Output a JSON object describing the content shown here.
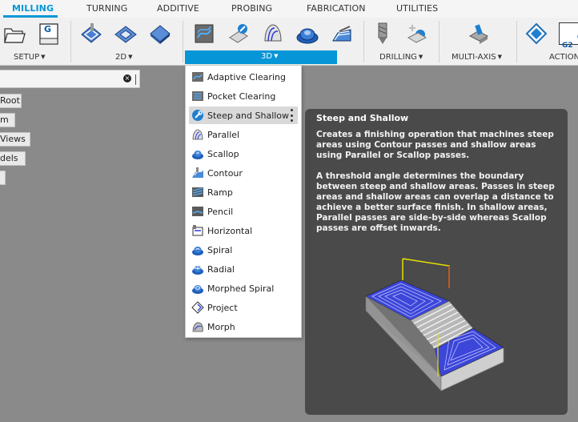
{
  "tabs": [
    {
      "label": "MILLING",
      "active": true
    },
    {
      "label": "TURNING",
      "active": false
    },
    {
      "label": "ADDITIVE",
      "active": false
    },
    {
      "label": "PROBING",
      "active": false
    },
    {
      "label": "FABRICATION",
      "active": false
    },
    {
      "label": "UTILITIES",
      "active": false
    }
  ],
  "groups": {
    "setup": "SETUP",
    "twod": "2D",
    "threed": "3D",
    "drilling": "DRILLING",
    "multiaxis": "MULTI-AXIS",
    "actions": "ACTION"
  },
  "nc_icon_text": "G1\nG2",
  "setup_sheet_letter": "G",
  "browser": {
    "search_clear_icon": "clear-icon",
    "chips": [
      "Root",
      "m",
      "Views",
      "dels",
      ""
    ]
  },
  "menu_items": [
    {
      "label": "Adaptive Clearing",
      "icon": "adaptive-clearing-icon"
    },
    {
      "label": "Pocket Clearing",
      "icon": "pocket-clearing-icon"
    },
    {
      "label": "Steep and Shallow",
      "icon": "steep-and-shallow-icon",
      "highlighted": true
    },
    {
      "label": "Parallel",
      "icon": "parallel-icon"
    },
    {
      "label": "Scallop",
      "icon": "scallop-icon"
    },
    {
      "label": "Contour",
      "icon": "contour-icon"
    },
    {
      "label": "Ramp",
      "icon": "ramp-icon"
    },
    {
      "label": "Pencil",
      "icon": "pencil-icon"
    },
    {
      "label": "Horizontal",
      "icon": "horizontal-icon"
    },
    {
      "label": "Spiral",
      "icon": "spiral-icon"
    },
    {
      "label": "Radial",
      "icon": "radial-icon"
    },
    {
      "label": "Morphed Spiral",
      "icon": "morphed-spiral-icon"
    },
    {
      "label": "Project",
      "icon": "project-icon"
    },
    {
      "label": "Morph",
      "icon": "morph-icon"
    }
  ],
  "tooltip": {
    "title": "Steep and Shallow",
    "para1": "Creates a finishing operation that machines steep areas using Contour passes and shallow areas using Parallel or Scallop passes.",
    "para2": "A threshold angle determines the boundary between steep and shallow areas. Passes in steep areas and shallow areas can overlap a distance to achieve a better surface finish. In shallow areas, Parallel passes are side-by-side whereas Scallop passes are offset inwards."
  },
  "colors": {
    "accent": "#0696d7",
    "toolpath": "#2a3bd6",
    "stock": "#a8a8a8",
    "tooltip_bg": "#4a4a4a"
  }
}
